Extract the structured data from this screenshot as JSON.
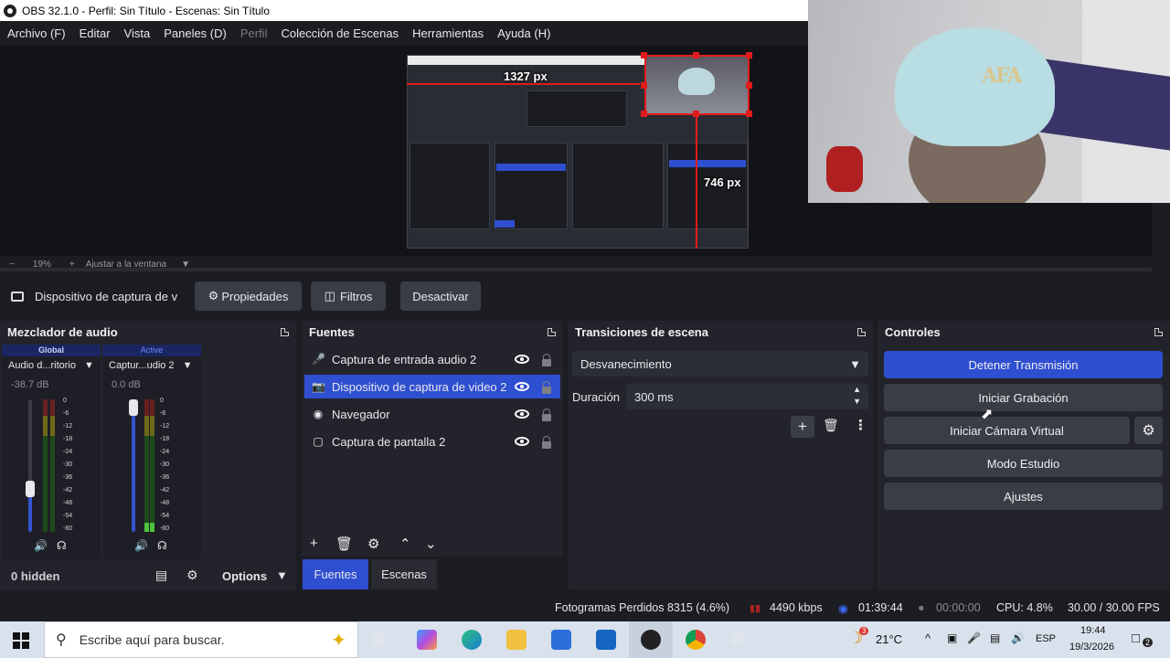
{
  "title": "OBS 32.1.0 - Perfil: Sin Título - Escenas: Sin Título",
  "menu": [
    "Archivo (F)",
    "Editar",
    "Vista",
    "Paneles (D)",
    "Perfil",
    "Colección de Escenas",
    "Herramientas",
    "Ayuda (H)"
  ],
  "preview": {
    "width_label": "1327 px",
    "height_label": "746 px",
    "zoom_minus": "−",
    "zoom_value": "19%",
    "zoom_plus": "+",
    "zoom_fit": "Ajustar a la ventana"
  },
  "source_toolbar": {
    "selected_source": "Dispositivo de captura de v",
    "properties": "Propiedades",
    "filters": "Filtros",
    "deactivate": "Desactivar"
  },
  "mixer": {
    "title": "Mezclador de audio",
    "channels": [
      {
        "header": "Global",
        "name": "Audio d...ritorio",
        "db": "-38.7 dB",
        "level": 0.0
      },
      {
        "header": "Active",
        "name": "Captur...udio 2",
        "db": "0.0 dB",
        "level": 0.06
      }
    ],
    "scale": [
      "0",
      "-6",
      "-12",
      "-18",
      "-24",
      "-30",
      "-36",
      "-42",
      "-48",
      "-54",
      "-60"
    ],
    "hidden": "0 hidden",
    "options": "Options"
  },
  "sources": {
    "title": "Fuentes",
    "items": [
      {
        "label": "Captura de entrada audio 2",
        "icon": "mic-icon"
      },
      {
        "label": "Dispositivo de captura de video 2",
        "icon": "camera-icon",
        "selected": true
      },
      {
        "label": "Navegador",
        "icon": "globe-icon"
      },
      {
        "label": "Captura de pantalla 2",
        "icon": "monitor-icon"
      }
    ],
    "tabs": [
      "Fuentes",
      "Escenas"
    ]
  },
  "transitions": {
    "title": "Transiciones de escena",
    "selected": "Desvanecimiento",
    "duration_label": "Duración",
    "duration_value": "300 ms"
  },
  "controls": {
    "title": "Controles",
    "stop_stream": "Detener Transmisión",
    "start_record": "Iniciar Grabación",
    "virtual_cam": "Iniciar Cámara Virtual",
    "studio_mode": "Modo Estudio",
    "settings": "Ajustes"
  },
  "status": {
    "dropped": "Fotogramas Perdidos 8315 (4.6%)",
    "kbps": "4490 kbps",
    "stream_time": "01:39:44",
    "rec_time": "00:00:00",
    "cpu": "CPU: 4.8%",
    "fps": "30.00 / 30.00 FPS"
  },
  "taskbar": {
    "search_placeholder": "Escribe aquí para buscar.",
    "weather_badge": "3",
    "temperature": "21°C",
    "language": "ESP",
    "time": "19:44",
    "date": "19/3/2026",
    "notifications": "2"
  },
  "colors": {
    "accent": "#2f4fd1",
    "panel": "#23242b",
    "bg": "#1c1d22",
    "rec_red": "#e21b1b"
  },
  "webcam_logo": "AFA"
}
